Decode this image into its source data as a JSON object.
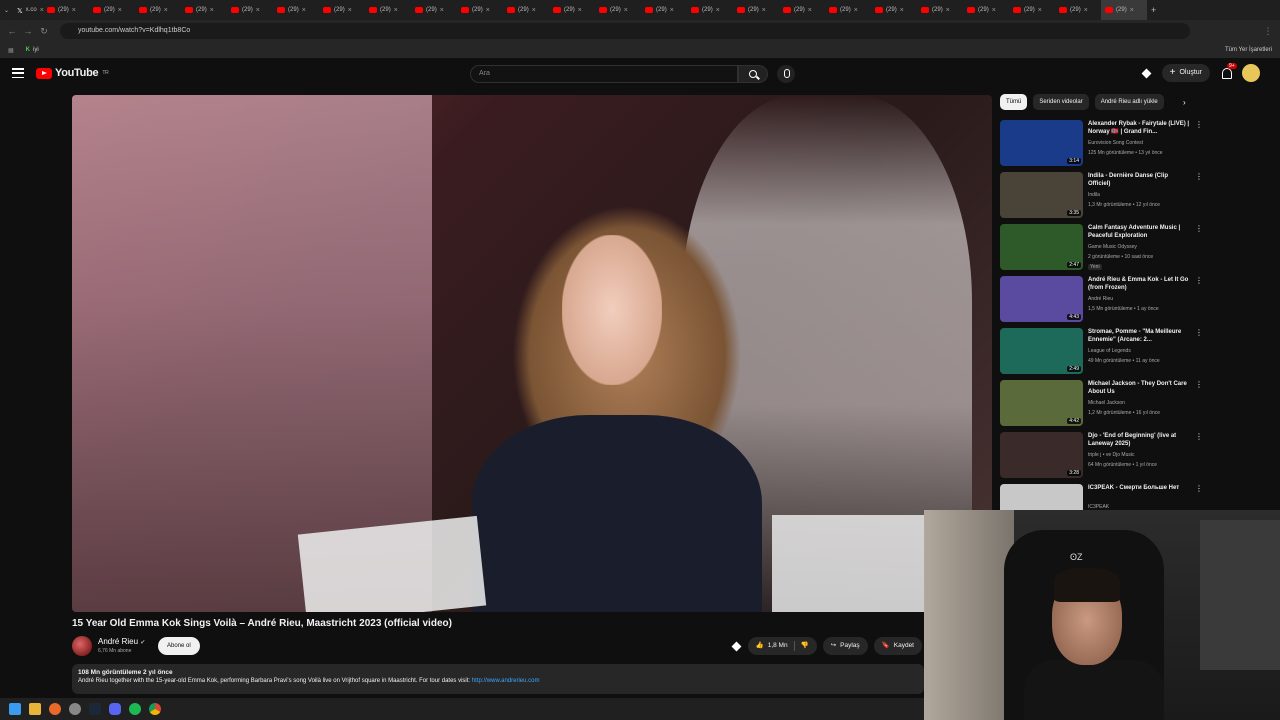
{
  "browser": {
    "tabs": [
      {
        "label": "x.co",
        "active": false
      },
      {
        "label": "(29)"
      },
      {
        "label": "(29)"
      },
      {
        "label": "(29)"
      },
      {
        "label": "(29)"
      },
      {
        "label": "(29)"
      },
      {
        "label": "(29)"
      },
      {
        "label": "(29)"
      },
      {
        "label": "(29)"
      },
      {
        "label": "(29)"
      },
      {
        "label": "(29)"
      },
      {
        "label": "(29)"
      },
      {
        "label": "(29)"
      },
      {
        "label": "(29)"
      },
      {
        "label": "(29)"
      },
      {
        "label": "(29)"
      },
      {
        "label": "(29)"
      },
      {
        "label": "(29)"
      },
      {
        "label": "(29)"
      },
      {
        "label": "(29)"
      },
      {
        "label": "(29)"
      },
      {
        "label": "(29)"
      },
      {
        "label": "(29)"
      },
      {
        "label": "(29)"
      },
      {
        "label": "(29)"
      }
    ],
    "url": "youtube.com/watch?v=Kdlhq1tb8Co",
    "bookmark_item": "iyi",
    "bookmarks_all": "Tüm Yer İşaretleri"
  },
  "youtube": {
    "logo_text": "YouTube",
    "logo_sup": "TR",
    "search_placeholder": "Ara",
    "create_label": "Oluştur",
    "notif_badge": "9+"
  },
  "video": {
    "title": "15 Year Old Emma Kok Sings Voilà – André Rieu, Maastricht 2023 (official video)",
    "channel": "André Rieu",
    "subscribers": "6,76 Mn abone",
    "subscribe_label": "Abone ol",
    "likes": "1,8 Mn",
    "share_label": "Paylaş",
    "save_label": "Kaydet",
    "views_age": "108 Mn görüntüleme  2 yıl önce",
    "description": "André Rieu together with the 15-year-old Emma Kok, performing Barbara Pravi's song Voilà live on Vrijthof square in Maastricht. For tour dates visit: ",
    "description_link": "http://www.andrerieu.com"
  },
  "chips": [
    "Tümü",
    "Seriden videolar",
    "André Rieu adlı yükle"
  ],
  "related": [
    {
      "title": "Alexander Rybak - Fairytale (LIVE) | Norway 🇳🇴 | Grand Fin...",
      "channel": "Eurovision Song Contest",
      "meta": "125 Mn görüntüleme • 13 yıl önce",
      "duration": "3:14",
      "color": "#1a3a8a"
    },
    {
      "title": "Indila - Dernière Danse (Clip Officiel)",
      "channel": "Indila",
      "meta": "1,3 Mr görüntüleme • 12 yıl önce",
      "duration": "3:35",
      "color": "#4a4438"
    },
    {
      "title": "Calm Fantasy Adventure Music | Peaceful Exploration",
      "channel": "Game Music Odyssey",
      "meta": "2 görüntüleme • 10 saat önce",
      "duration": "2:47",
      "color": "#2e5a2a",
      "new": "Yeni"
    },
    {
      "title": "André Rieu & Emma Kok - Let It Go (from Frozen)",
      "channel": "André Rieu",
      "meta": "1,5 Mn görüntüleme • 1 ay önce",
      "duration": "4:43",
      "color": "#5a4aa0"
    },
    {
      "title": "Stromae, Pomme - \"Ma Meilleure Ennemie\" (Arcane: 2...",
      "channel": "League of Legends",
      "meta": "49 Mn görüntüleme • 11 ay önce",
      "duration": "2:49",
      "color": "#1e6a5a"
    },
    {
      "title": "Michael Jackson - They Don't Care About Us",
      "channel": "Michael Jackson",
      "meta": "1,2 Mr görüntüleme • 16 yıl önce",
      "duration": "4:42",
      "color": "#5a6a3a"
    },
    {
      "title": "Djo - 'End of Beginning' (live at Laneway 2025)",
      "channel": "triple j • ve Djo Music",
      "meta": "64 Mn görüntüleme • 1 yıl önce",
      "duration": "3:28",
      "color": "#3a2a2a"
    },
    {
      "title": "IC3PEAK - Смерти Больше Нет",
      "channel": "IC3PEAK",
      "meta": "179 Mn görüntüleme • 7 yıl önce",
      "duration": "",
      "color": "#c8c8c8"
    }
  ]
}
